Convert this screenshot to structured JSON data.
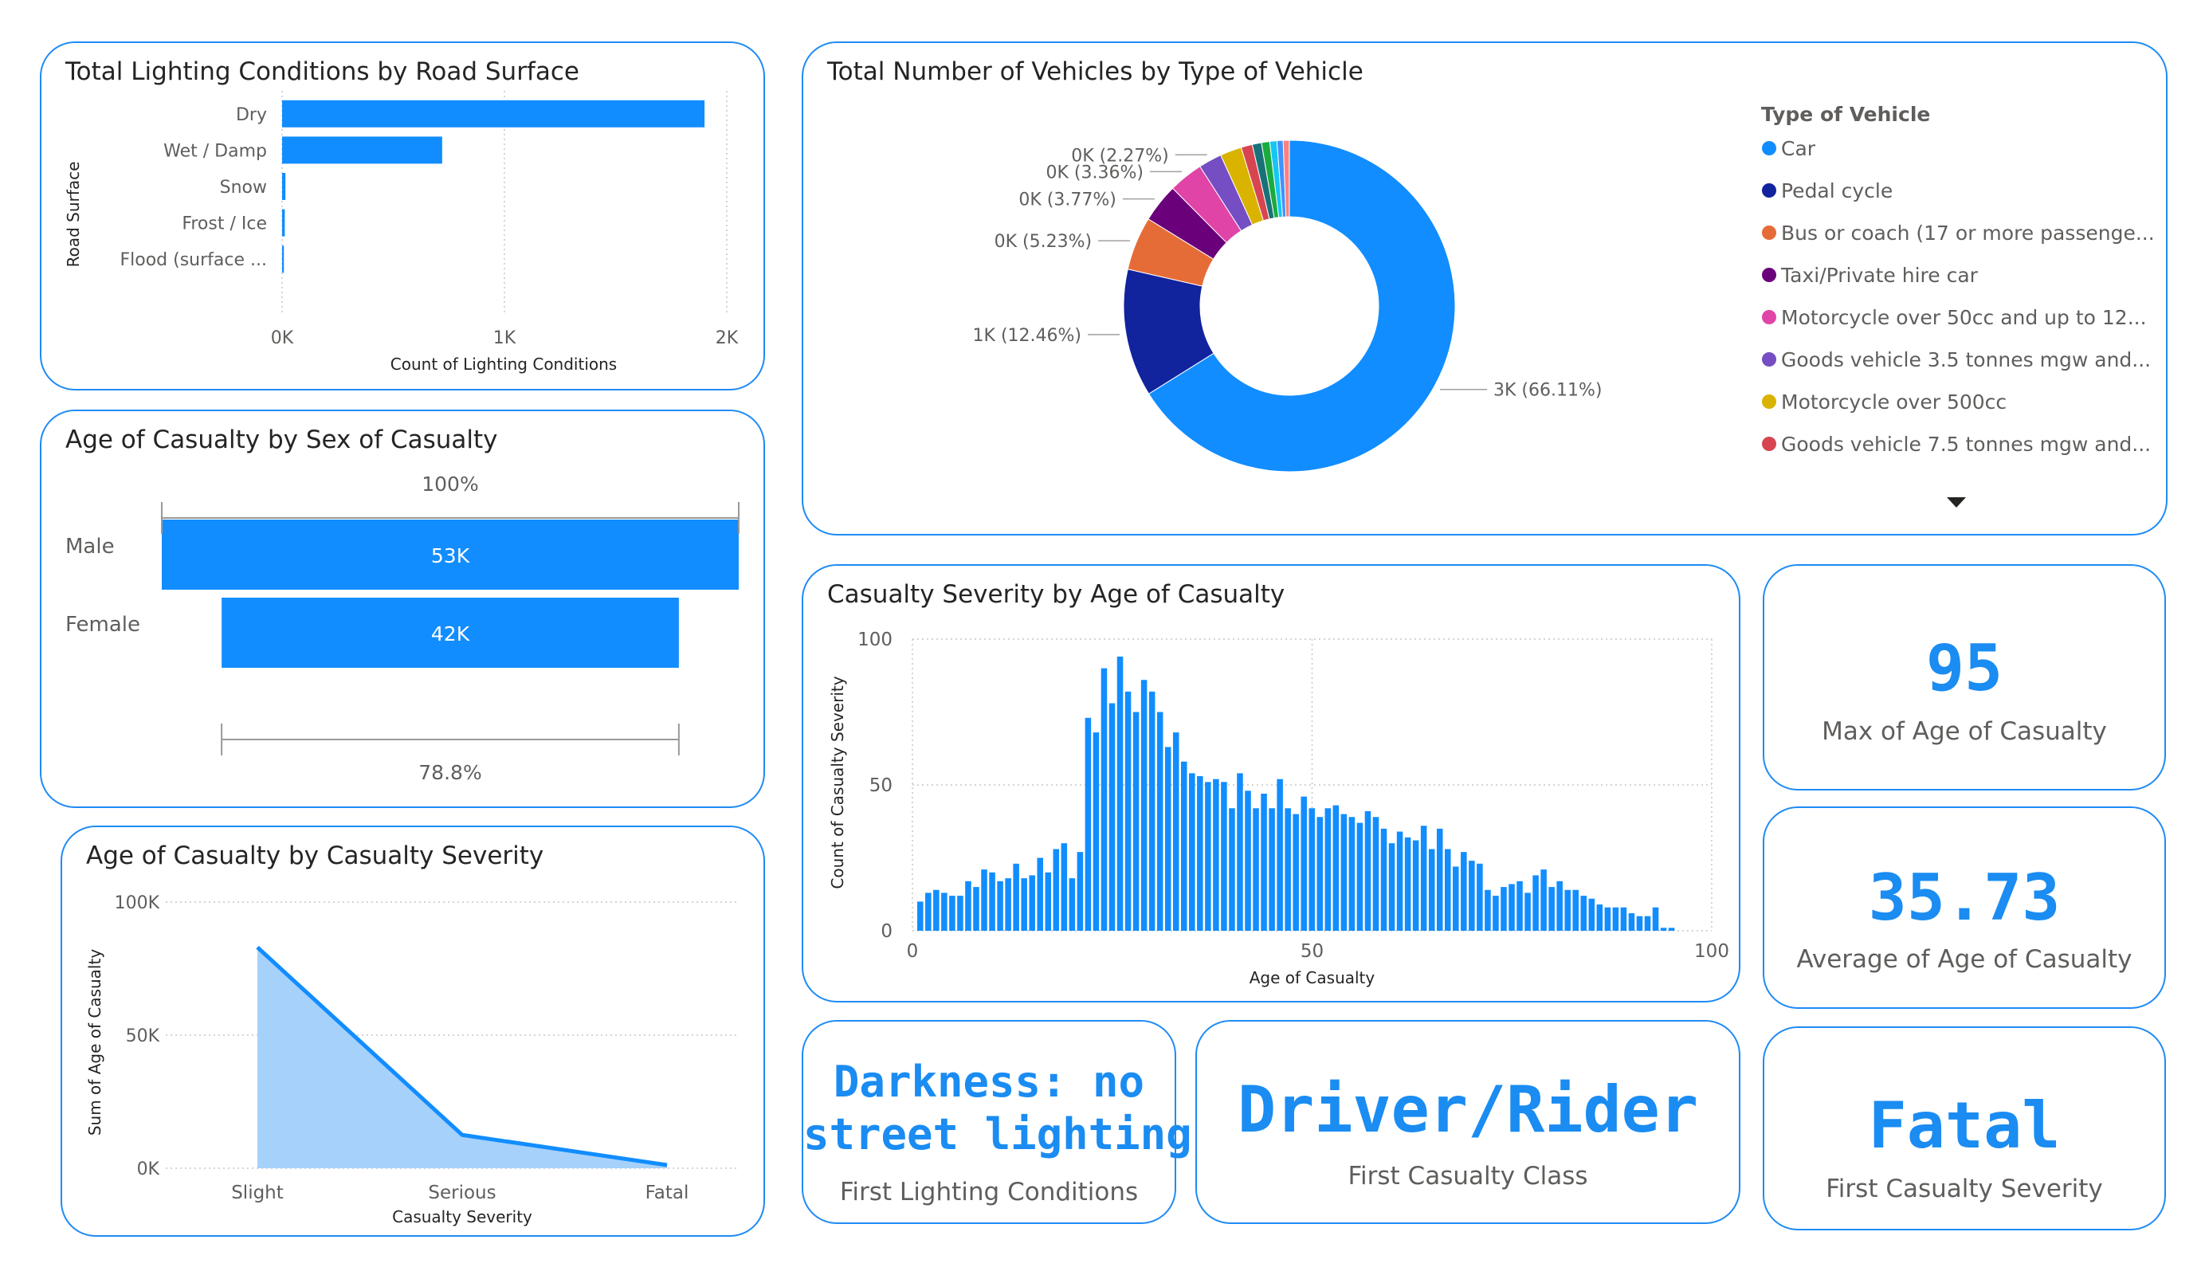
{
  "theme": {
    "accent": "#1f8bf5",
    "bar": "#118dff",
    "area_fill": "#a6d1fb",
    "border": "#1f8bf5"
  },
  "cards": {
    "road_surface": {
      "title": "Total Lighting Conditions by Road Surface"
    },
    "sex": {
      "title": "Age of Casualty by Sex of Casualty"
    },
    "severity_area": {
      "title": "Age of Casualty by Casualty Severity"
    },
    "vehicles": {
      "title": "Total Number of Vehicles by Type of Vehicle"
    },
    "age_hist": {
      "title": "Casualty Severity by Age of Casualty"
    }
  },
  "kpis": {
    "max_age": {
      "value": "95",
      "label": "Max of Age of Casualty"
    },
    "avg_age": {
      "value": "35.73",
      "label": "Average of Age of Casualty"
    },
    "lighting": {
      "value_line1": "Darkness: no",
      "value_line2": "street lighting",
      "label": "First Lighting Conditions"
    },
    "casualty_class": {
      "value": "Driver/Rider",
      "label": "First Casualty Class"
    },
    "severity": {
      "value": "Fatal",
      "label": "First Casualty Severity"
    }
  },
  "chart_data": [
    {
      "id": "road_surface",
      "type": "bar",
      "orientation": "horizontal",
      "title": "Total Lighting Conditions by Road Surface",
      "xlabel": "Count of Lighting Conditions",
      "ylabel": "Road Surface",
      "categories": [
        "Dry",
        "Wet / Damp",
        "Snow",
        "Frost / Ice",
        "Flood (surface ..."
      ],
      "values": [
        1900,
        720,
        15,
        12,
        8
      ],
      "xlim": [
        0,
        2000
      ],
      "xticks": [
        "0K",
        "1K",
        "2K"
      ],
      "grid": true
    },
    {
      "id": "sex",
      "type": "bar",
      "orientation": "horizontal",
      "title": "Age of Casualty by Sex of Casualty",
      "categories": [
        "Male",
        "Female"
      ],
      "values": [
        53000,
        42000
      ],
      "data_labels": [
        "53K",
        "42K"
      ],
      "percent_labels": [
        "100%",
        "78.8%"
      ]
    },
    {
      "id": "severity_area",
      "type": "area",
      "title": "Age of Casualty by Casualty Severity",
      "xlabel": "Casualty Severity",
      "ylabel": "Sum of Age of Casualty",
      "categories": [
        "Slight",
        "Serious",
        "Fatal"
      ],
      "values": [
        83000,
        12500,
        1200
      ],
      "ylim": [
        0,
        100000
      ],
      "yticks": [
        {
          "v": 100000,
          "label": "100K"
        },
        {
          "v": 50000,
          "label": "50K"
        },
        {
          "v": 0,
          "label": "0K"
        }
      ],
      "grid": true
    },
    {
      "id": "vehicles",
      "type": "pie",
      "donut": true,
      "title": "Total Number of Vehicles by Type of Vehicle",
      "legend_title": "Type of Vehicle",
      "legend_position": "right",
      "legend": [
        {
          "label": "Car",
          "color": "#118dff"
        },
        {
          "label": "Pedal cycle",
          "color": "#12239e"
        },
        {
          "label": "Bus or coach (17 or more passenge...",
          "color": "#e66c37"
        },
        {
          "label": "Taxi/Private hire car",
          "color": "#6b007b"
        },
        {
          "label": "Motorcycle over 50cc and up to 12...",
          "color": "#e044a7"
        },
        {
          "label": "Goods vehicle 3.5 tonnes mgw and...",
          "color": "#744ec2"
        },
        {
          "label": "Motorcycle over 500cc",
          "color": "#d9b300"
        },
        {
          "label": "Goods vehicle 7.5 tonnes mgw and...",
          "color": "#d64550"
        }
      ],
      "slices": [
        {
          "percent": 66.11,
          "color": "#118dff",
          "label": "3K (66.11%)"
        },
        {
          "percent": 12.46,
          "color": "#12239e",
          "label": "1K (12.46%)"
        },
        {
          "percent": 5.23,
          "color": "#e66c37",
          "label": "0K (5.23%)"
        },
        {
          "percent": 3.77,
          "color": "#6b007b",
          "label": "0K (3.77%)"
        },
        {
          "percent": 3.36,
          "color": "#e044a7",
          "label": "0K (3.36%)"
        },
        {
          "percent": 2.27,
          "color": "#744ec2",
          "label": "0K (2.27%)"
        },
        {
          "percent": 2.1,
          "color": "#d9b300",
          "label": ""
        },
        {
          "percent": 1.1,
          "color": "#d64550",
          "label": ""
        },
        {
          "percent": 0.9,
          "color": "#197278",
          "label": ""
        },
        {
          "percent": 0.8,
          "color": "#1aab40",
          "label": ""
        },
        {
          "percent": 0.7,
          "color": "#15c6f4",
          "label": ""
        },
        {
          "percent": 0.6,
          "color": "#4092ff",
          "label": ""
        },
        {
          "percent": 0.59,
          "color": "#ff8080",
          "label": ""
        }
      ]
    },
    {
      "id": "age_hist",
      "type": "bar",
      "title": "Casualty Severity by Age of Casualty",
      "xlabel": "Age of Casualty",
      "ylabel": "Count of Casualty Severity",
      "xlim": [
        0,
        100
      ],
      "ylim": [
        0,
        100
      ],
      "xticks": [
        0,
        50,
        100
      ],
      "yticks": [
        0,
        50,
        100
      ],
      "x": [
        1,
        2,
        3,
        4,
        5,
        6,
        7,
        8,
        9,
        10,
        11,
        12,
        13,
        14,
        15,
        16,
        17,
        18,
        19,
        20,
        21,
        22,
        23,
        24,
        25,
        26,
        27,
        28,
        29,
        30,
        31,
        32,
        33,
        34,
        35,
        36,
        37,
        38,
        39,
        40,
        41,
        42,
        43,
        44,
        45,
        46,
        47,
        48,
        49,
        50,
        51,
        52,
        53,
        54,
        55,
        56,
        57,
        58,
        59,
        60,
        61,
        62,
        63,
        64,
        65,
        66,
        67,
        68,
        69,
        70,
        71,
        72,
        73,
        74,
        75,
        76,
        77,
        78,
        79,
        80,
        81,
        82,
        83,
        84,
        85,
        86,
        87,
        88,
        89,
        90,
        91,
        92,
        93,
        94,
        95
      ],
      "values": [
        10,
        13,
        14,
        13,
        12,
        12,
        17,
        15,
        21,
        20,
        17,
        18,
        23,
        18,
        19,
        25,
        20,
        28,
        30,
        18,
        27,
        73,
        68,
        90,
        78,
        94,
        82,
        75,
        86,
        82,
        75,
        63,
        68,
        58,
        54,
        53,
        51,
        52,
        51,
        42,
        54,
        48,
        42,
        47,
        42,
        52,
        42,
        40,
        46,
        42,
        39,
        42,
        43,
        40,
        39,
        37,
        41,
        39,
        35,
        30,
        34,
        32,
        31,
        36,
        28,
        35,
        28,
        22,
        27,
        24,
        23,
        14,
        12,
        15,
        16,
        17,
        13,
        19,
        21,
        15,
        17,
        14,
        14,
        12,
        11,
        9,
        8,
        8,
        8,
        6,
        5,
        5,
        8,
        1,
        1,
        2,
        1,
        1
      ],
      "grid": true
    }
  ]
}
